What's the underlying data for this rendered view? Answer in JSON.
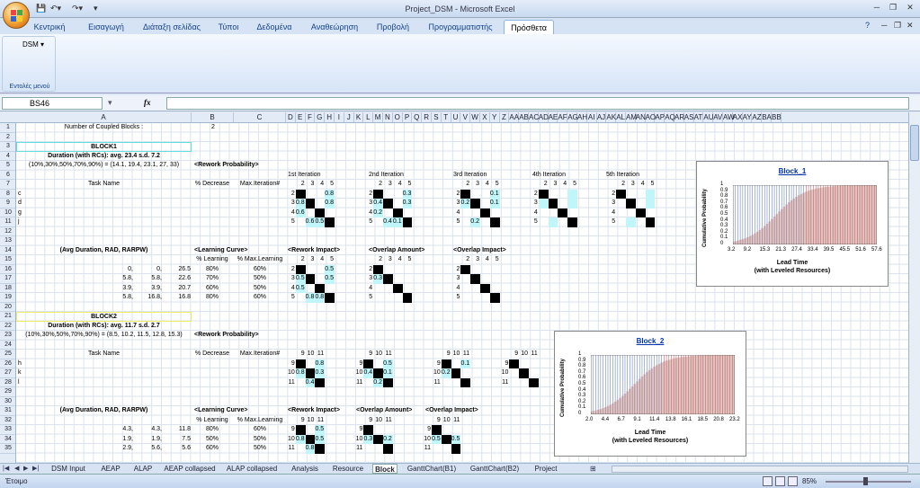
{
  "window": {
    "title": "Project_DSM - Microsoft Excel"
  },
  "ribbon": {
    "tabs": [
      "Κεντρική",
      "Εισαγωγή",
      "Διάταξη σελίδας",
      "Τύποι",
      "Δεδομένα",
      "Αναθεώρηση",
      "Προβολή",
      "Προγραμματιστής",
      "Πρόσθετα"
    ],
    "active_tab": "Πρόσθετα",
    "group_button": "DSM ▾",
    "group_label": "Εντολές μενού"
  },
  "formula": {
    "namebox": "BS46",
    "fx": "fx",
    "value": ""
  },
  "columns": [
    "A",
    "B",
    "C",
    "D",
    "E",
    "F",
    "G",
    "H",
    "I",
    "J",
    "K",
    "L",
    "M",
    "N",
    "O",
    "P",
    "Q",
    "R",
    "S",
    "T",
    "U",
    "V",
    "W",
    "X",
    "Y",
    "Z",
    "AA",
    "AB",
    "AC",
    "AD",
    "AE",
    "AF",
    "AG",
    "AH",
    "AI",
    "AJ",
    "AK",
    "AL",
    "AM",
    "AN",
    "AO",
    "AP",
    "AQ",
    "AR",
    "AS",
    "AT",
    "AU",
    "AV",
    "AW",
    "AX",
    "AY",
    "AZ",
    "BA",
    "BB"
  ],
  "rows": [
    "1",
    "2",
    "3",
    "4",
    "5",
    "6",
    "7",
    "8",
    "9",
    "10",
    "11",
    "12",
    "13",
    "14",
    "15",
    "16",
    "17",
    "18",
    "19",
    "20",
    "21",
    "22",
    "23",
    "24",
    "25",
    "26",
    "27",
    "28",
    "29",
    "30",
    "31",
    "32",
    "33",
    "34",
    "35"
  ],
  "sheet": {
    "r1": {
      "label": "Number of Coupled Blocks :",
      "value": "2"
    },
    "block1": {
      "title": "BLOCK1",
      "duration": "Duration (with RCs): avg. 23.4 s.d. 7.2",
      "pct": "(10%,30%,50%,70%,90%) = (14.1, 19.4, 23.1, 27, 33)",
      "rework_prob": "<Rework Probability>",
      "iterations": [
        "1st Iteration",
        "2nd Iteration",
        "3rd Iteration",
        "4th Iteration",
        "5th Iteration"
      ],
      "task_header": "Task Name",
      "pct_dec": "% Decrease",
      "max_iter": "Max.Iteration#",
      "tasks": [
        "c",
        "d",
        "g",
        "j"
      ],
      "idx": [
        "2",
        "3",
        "4",
        "5"
      ],
      "it1": [
        [
          "",
          "",
          "",
          "0.8"
        ],
        [
          "0.8",
          "",
          "",
          "0.8"
        ],
        [
          "0.6",
          "",
          "",
          ""
        ],
        [
          "",
          "0.6",
          "0.5",
          ""
        ]
      ],
      "it2": [
        [
          "",
          "",
          "",
          "0.3"
        ],
        [
          "0.4",
          "",
          "",
          "0.3"
        ],
        [
          "0.2",
          "",
          "",
          ""
        ],
        [
          "",
          "0.4",
          "0.1",
          ""
        ]
      ],
      "it3": [
        [
          "",
          "",
          "",
          "0.1"
        ],
        [
          "0.2",
          "",
          "",
          "0.1"
        ],
        [
          "",
          "",
          "",
          ""
        ],
        [
          "",
          "0.2",
          "",
          ""
        ]
      ],
      "avg_hdr": "(Avg Duration, RAD, RARPW)",
      "learning": "<Learning Curve>",
      "pct_learning": "% Learning",
      "pct_max_learning": "% Max.Learning",
      "rework_impact": "<Rework Impact>",
      "overlap_amount": "<Overlap Amount>",
      "overlap_impact": "<Overlap Impact>",
      "avg": [
        [
          "0,",
          "0,",
          "26.5"
        ],
        [
          "5.8,",
          "5.8,",
          "22.6"
        ],
        [
          "3.9,",
          "3.9,",
          "20.7"
        ],
        [
          "5.8,",
          "16.8,",
          "16.8"
        ]
      ],
      "learn": [
        [
          "80%",
          "60%"
        ],
        [
          "70%",
          "50%"
        ],
        [
          "60%",
          "50%"
        ],
        [
          "80%",
          "60%"
        ]
      ],
      "ri": [
        [
          "",
          "",
          "",
          "0.5"
        ],
        [
          "0.5",
          "",
          "",
          "0.5"
        ],
        [
          "0.5",
          "",
          "",
          ""
        ],
        [
          "",
          "0.8",
          "0.8",
          ""
        ]
      ],
      "oa": [
        [
          "",
          "",
          "",
          ""
        ],
        [
          "0.3",
          "",
          "",
          ""
        ],
        [
          "",
          "",
          "",
          ""
        ],
        [
          "",
          "",
          "",
          ""
        ]
      ]
    },
    "block2": {
      "title": "BLOCK2",
      "duration": "Duration (with RCs): avg. 11.7 s.d. 2.7",
      "pct": "(10%,30%,50%,70%,90%) = (8.5, 10.2, 11.5, 12.8, 15.3)",
      "rework_prob": "<Rework Probability>",
      "tasks": [
        "h",
        "k",
        "l"
      ],
      "idx": [
        "9",
        "10",
        "11"
      ],
      "it1": [
        [
          "",
          "",
          "0.8"
        ],
        [
          "0.8",
          "",
          "0.3"
        ],
        [
          "",
          "0.4",
          ""
        ]
      ],
      "it2": [
        [
          "",
          "",
          "0.5"
        ],
        [
          "0.4",
          "",
          "0.1"
        ],
        [
          "",
          "0.2",
          ""
        ]
      ],
      "it3": [
        [
          "",
          "",
          "0.1"
        ],
        [
          "0.2",
          "",
          ""
        ],
        [
          "",
          "",
          ""
        ]
      ],
      "avg": [
        [
          "4.3,",
          "4.3,",
          "11.8"
        ],
        [
          "1.9,",
          "1.9,",
          "7.5"
        ],
        [
          "2.9,",
          "5.6,",
          "5.6"
        ]
      ],
      "learn": [
        [
          "80%",
          "60%"
        ],
        [
          "50%",
          "50%"
        ],
        [
          "60%",
          "50%"
        ]
      ],
      "ri": [
        [
          "",
          "",
          "0.5"
        ],
        [
          "0.8",
          "",
          "0.5"
        ],
        [
          "",
          "0.8",
          ""
        ]
      ],
      "oa": [
        [
          "",
          "",
          ""
        ],
        [
          "0.3",
          "",
          "0.2"
        ],
        [
          "",
          "",
          ""
        ]
      ],
      "oi": [
        [
          "",
          "",
          ""
        ],
        [
          "0.5",
          "",
          "0.5"
        ],
        [
          "",
          "",
          ""
        ]
      ]
    }
  },
  "charts": [
    {
      "title": "Block_1",
      "xlabel": "Lead Time",
      "xlabel2": "(with Leveled Resources)",
      "ylabel": "Cumulative Probability",
      "yticks": [
        "1",
        "0.9",
        "0.8",
        "0.7",
        "0.6",
        "0.5",
        "0.4",
        "0.3",
        "0.2",
        "0.1",
        "0"
      ],
      "xticks": [
        "3.2",
        "9.2",
        "15.3",
        "21.3",
        "27.4",
        "33.4",
        "39.5",
        "45.5",
        "51.6",
        "57.6"
      ]
    },
    {
      "title": "Block_2",
      "xlabel": "Lead Time",
      "xlabel2": "(with Leveled Resources)",
      "ylabel": "Cumulative Probability",
      "yticks": [
        "1",
        "0.9",
        "0.8",
        "0.7",
        "0.6",
        "0.5",
        "0.4",
        "0.3",
        "0.2",
        "0.1",
        "0"
      ],
      "xticks": [
        "2.0",
        "4.4",
        "6.7",
        "9.1",
        "11.4",
        "13.8",
        "16.1",
        "18.5",
        "20.8",
        "23.2"
      ]
    }
  ],
  "sheets": [
    "DSM Input",
    "AEAP",
    "ALAP",
    "AEAP collapsed",
    "ALAP collapsed",
    "Analysis",
    "Resource",
    "Block",
    "GanttChart(B1)",
    "GanttChart(B2)",
    "Project"
  ],
  "active_sheet": "Block",
  "status": {
    "text": "Έτοιμο",
    "zoom": "85%"
  }
}
